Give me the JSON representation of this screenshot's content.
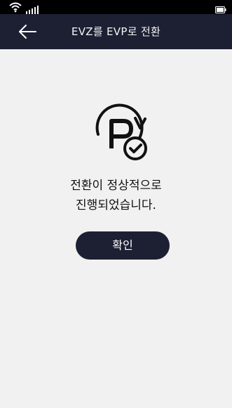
{
  "header": {
    "title": "EVZ를 EVP로 전환",
    "back_icon": "arrow-left-icon"
  },
  "status": {
    "wifi_icon": "wifi-icon",
    "signal_icon": "signal-icon",
    "battery_icon": "battery-icon"
  },
  "main": {
    "icon": "parking-check-refresh-icon",
    "message": {
      "line1": "전환이 정상적으로",
      "line2": "진행되었습니다."
    },
    "confirm_label": "확인"
  },
  "colors": {
    "status_bar": "#000000",
    "title_bar": "#1d2033",
    "background": "#f1f1f1",
    "button": "#1d2033"
  }
}
